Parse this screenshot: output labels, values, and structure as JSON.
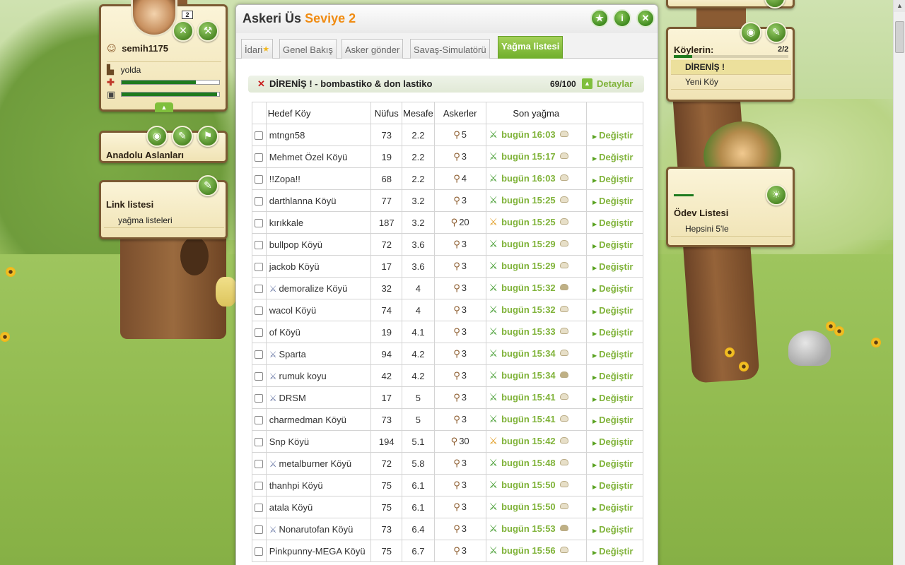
{
  "window": {
    "title": "Askeri Üs",
    "level": "Seviye 2",
    "header_buttons": [
      "star-icon",
      "info-icon",
      "close-icon"
    ]
  },
  "tabs": [
    {
      "label": "İdari",
      "active": false
    },
    {
      "label": "Genel Bakış",
      "active": false
    },
    {
      "label": "Asker gönder",
      "active": false
    },
    {
      "label": "Savaş-Simulatörü",
      "active": false
    },
    {
      "label": "Yağma listesi",
      "active": true
    }
  ],
  "farm_list": {
    "name": "DİRENİŞ ! - bombastiko & don lastiko",
    "count": "69/100",
    "details_label": "Detaylar"
  },
  "table": {
    "headers": [
      "Hedef Köy",
      "Nüfus",
      "Mesafe",
      "Askerler",
      "Son yağma"
    ],
    "change_label": "Değiştir",
    "rows": [
      {
        "name": "mtngn58",
        "pop": "73",
        "dist": "2.2",
        "troops": "5",
        "raid": "bugün 16:03",
        "attack": false,
        "raid_color": "green",
        "bag_full": false
      },
      {
        "name": "Mehmet Özel Köyü",
        "pop": "19",
        "dist": "2.2",
        "troops": "3",
        "raid": "bugün 15:17",
        "attack": false,
        "raid_color": "green",
        "bag_full": false
      },
      {
        "name": "!!Zopa!!",
        "pop": "68",
        "dist": "2.2",
        "troops": "4",
        "raid": "bugün 16:03",
        "attack": false,
        "raid_color": "green",
        "bag_full": false
      },
      {
        "name": "darthlanna Köyü",
        "pop": "77",
        "dist": "3.2",
        "troops": "3",
        "raid": "bugün 15:25",
        "attack": false,
        "raid_color": "green",
        "bag_full": false
      },
      {
        "name": "kırıkkale",
        "pop": "187",
        "dist": "3.2",
        "troops": "20",
        "raid": "bugün 15:25",
        "attack": false,
        "raid_color": "orange",
        "bag_full": false
      },
      {
        "name": "bullpop Köyü",
        "pop": "72",
        "dist": "3.6",
        "troops": "3",
        "raid": "bugün 15:29",
        "attack": false,
        "raid_color": "green",
        "bag_full": false
      },
      {
        "name": "jackob Köyü",
        "pop": "17",
        "dist": "3.6",
        "troops": "3",
        "raid": "bugün 15:29",
        "attack": false,
        "raid_color": "green",
        "bag_full": false
      },
      {
        "name": "demoralize Köyü",
        "pop": "32",
        "dist": "4",
        "troops": "3",
        "raid": "bugün 15:32",
        "attack": true,
        "raid_color": "green",
        "bag_full": true
      },
      {
        "name": "wacol Köyü",
        "pop": "74",
        "dist": "4",
        "troops": "3",
        "raid": "bugün 15:32",
        "attack": false,
        "raid_color": "green",
        "bag_full": false
      },
      {
        "name": "of Köyü",
        "pop": "19",
        "dist": "4.1",
        "troops": "3",
        "raid": "bugün 15:33",
        "attack": false,
        "raid_color": "green",
        "bag_full": false
      },
      {
        "name": "Sparta",
        "pop": "94",
        "dist": "4.2",
        "troops": "3",
        "raid": "bugün 15:34",
        "attack": true,
        "raid_color": "green",
        "bag_full": false
      },
      {
        "name": "rumuk koyu",
        "pop": "42",
        "dist": "4.2",
        "troops": "3",
        "raid": "bugün 15:34",
        "attack": true,
        "raid_color": "green",
        "bag_full": true
      },
      {
        "name": "DRSM",
        "pop": "17",
        "dist": "5",
        "troops": "3",
        "raid": "bugün 15:41",
        "attack": true,
        "raid_color": "green",
        "bag_full": false
      },
      {
        "name": "charmedman Köyü",
        "pop": "73",
        "dist": "5",
        "troops": "3",
        "raid": "bugün 15:41",
        "attack": false,
        "raid_color": "green",
        "bag_full": false
      },
      {
        "name": "Snp Köyü",
        "pop": "194",
        "dist": "5.1",
        "troops": "30",
        "raid": "bugün 15:42",
        "attack": false,
        "raid_color": "orange",
        "bag_full": false
      },
      {
        "name": "metalburner Köyü",
        "pop": "72",
        "dist": "5.8",
        "troops": "3",
        "raid": "bugün 15:48",
        "attack": true,
        "raid_color": "green",
        "bag_full": false
      },
      {
        "name": "thanhpi Köyü",
        "pop": "75",
        "dist": "6.1",
        "troops": "3",
        "raid": "bugün 15:50",
        "attack": false,
        "raid_color": "green",
        "bag_full": false
      },
      {
        "name": "atala Köyü",
        "pop": "75",
        "dist": "6.1",
        "troops": "3",
        "raid": "bugün 15:50",
        "attack": false,
        "raid_color": "green",
        "bag_full": false
      },
      {
        "name": "Nonarutofan Köyü",
        "pop": "73",
        "dist": "6.4",
        "troops": "3",
        "raid": "bugün 15:53",
        "attack": true,
        "raid_color": "green",
        "bag_full": true
      },
      {
        "name": "Pinkpunny-MEGA Köyü",
        "pop": "75",
        "dist": "6.7",
        "troops": "3",
        "raid": "bugün 15:56",
        "attack": false,
        "raid_color": "green",
        "bag_full": false
      }
    ]
  },
  "player": {
    "name": "semih1175",
    "status": "yolda",
    "badge": "2"
  },
  "alliance": {
    "name": "Anadolu Aslanları"
  },
  "links": {
    "title": "Link listesi",
    "items": [
      "yağma listeleri"
    ]
  },
  "villages": {
    "title": "Köylerin:",
    "count": "2/2",
    "items": [
      {
        "name": "DİRENİŞ !",
        "active": true
      },
      {
        "name": "Yeni Köy",
        "active": false
      }
    ]
  },
  "quests": {
    "title": "Ödev Listesi",
    "items": [
      "Hepsini 5'le"
    ]
  },
  "colors": {
    "accent_green": "#80b33a",
    "level_orange": "#f08c13",
    "panel_border": "#7b5a33"
  }
}
